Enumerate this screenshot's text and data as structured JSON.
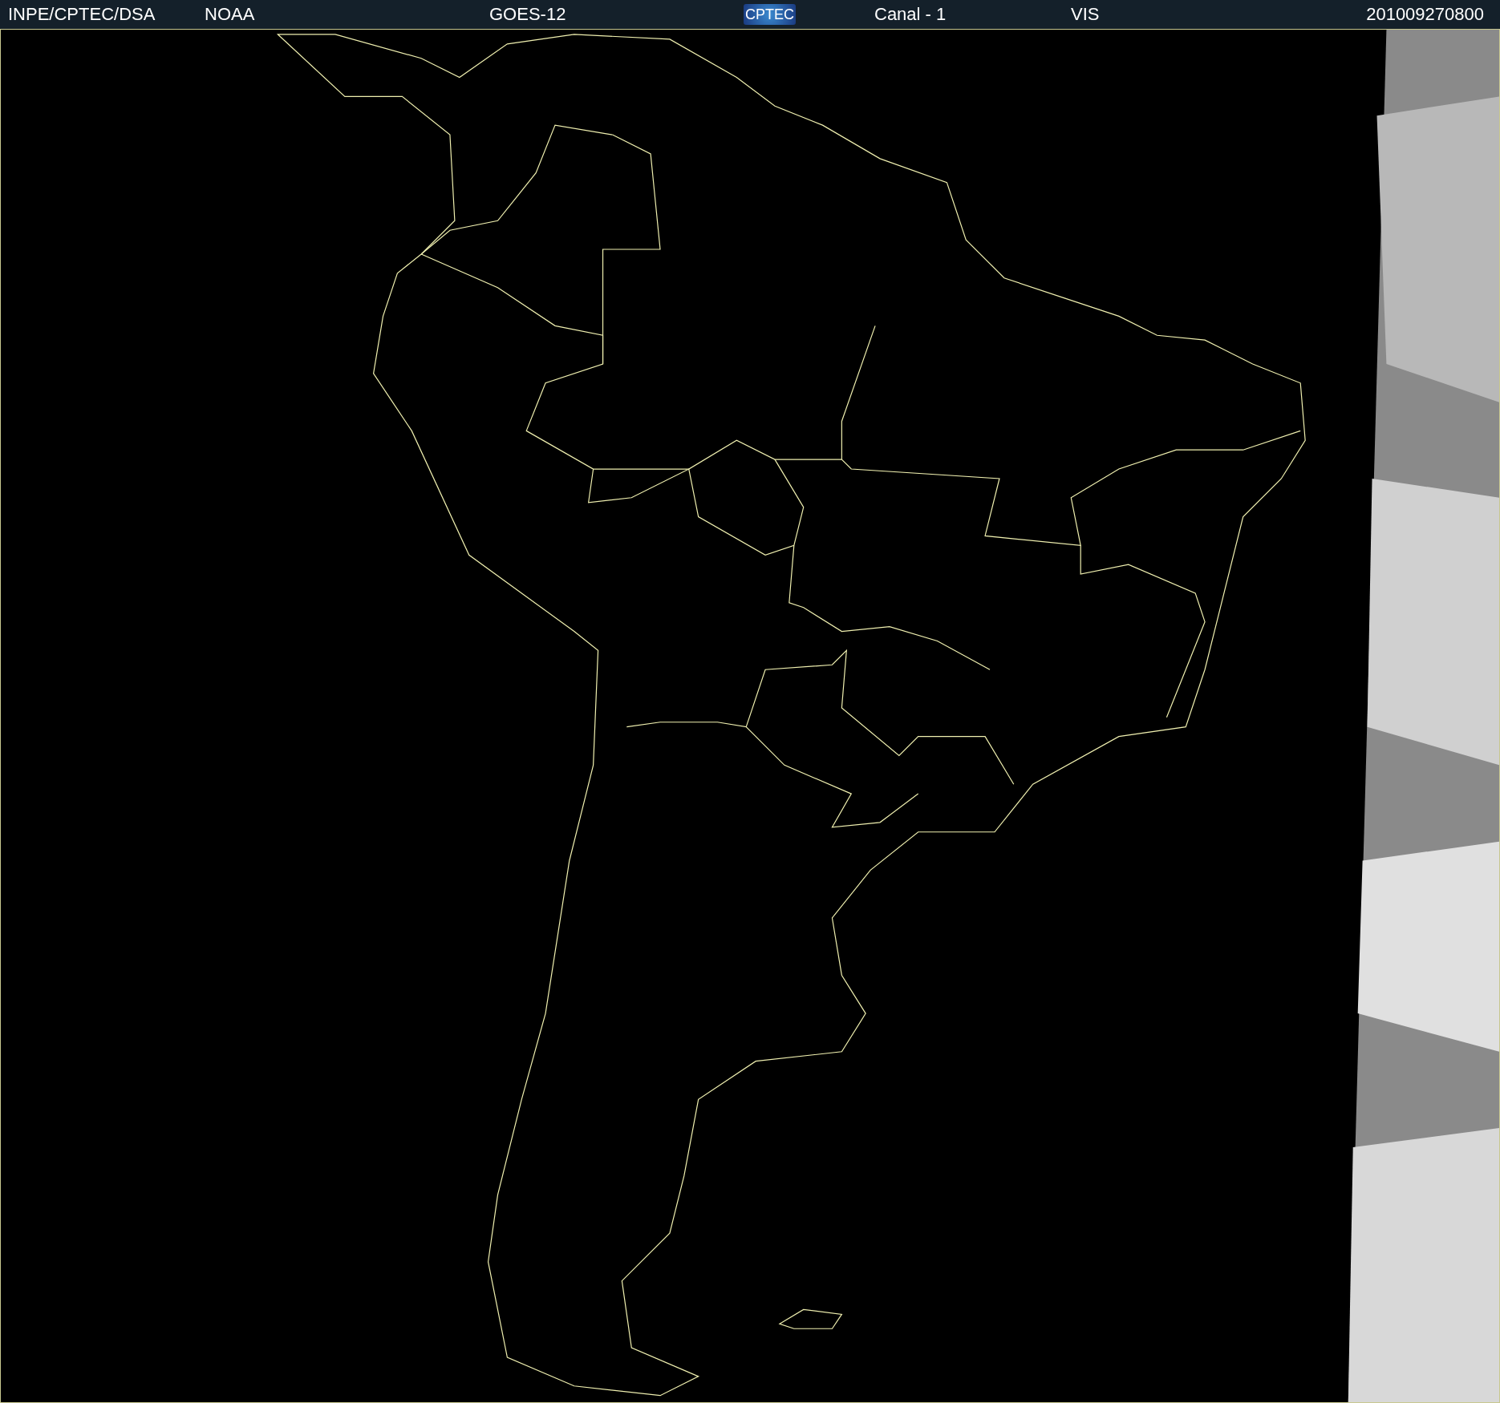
{
  "header": {
    "agency": "INPE/CPTEC/DSA",
    "source": "NOAA",
    "satellite": "GOES-12",
    "logo": "CPTEC",
    "channel": "Canal - 1",
    "band": "VIS",
    "timestamp": "201009270800"
  }
}
